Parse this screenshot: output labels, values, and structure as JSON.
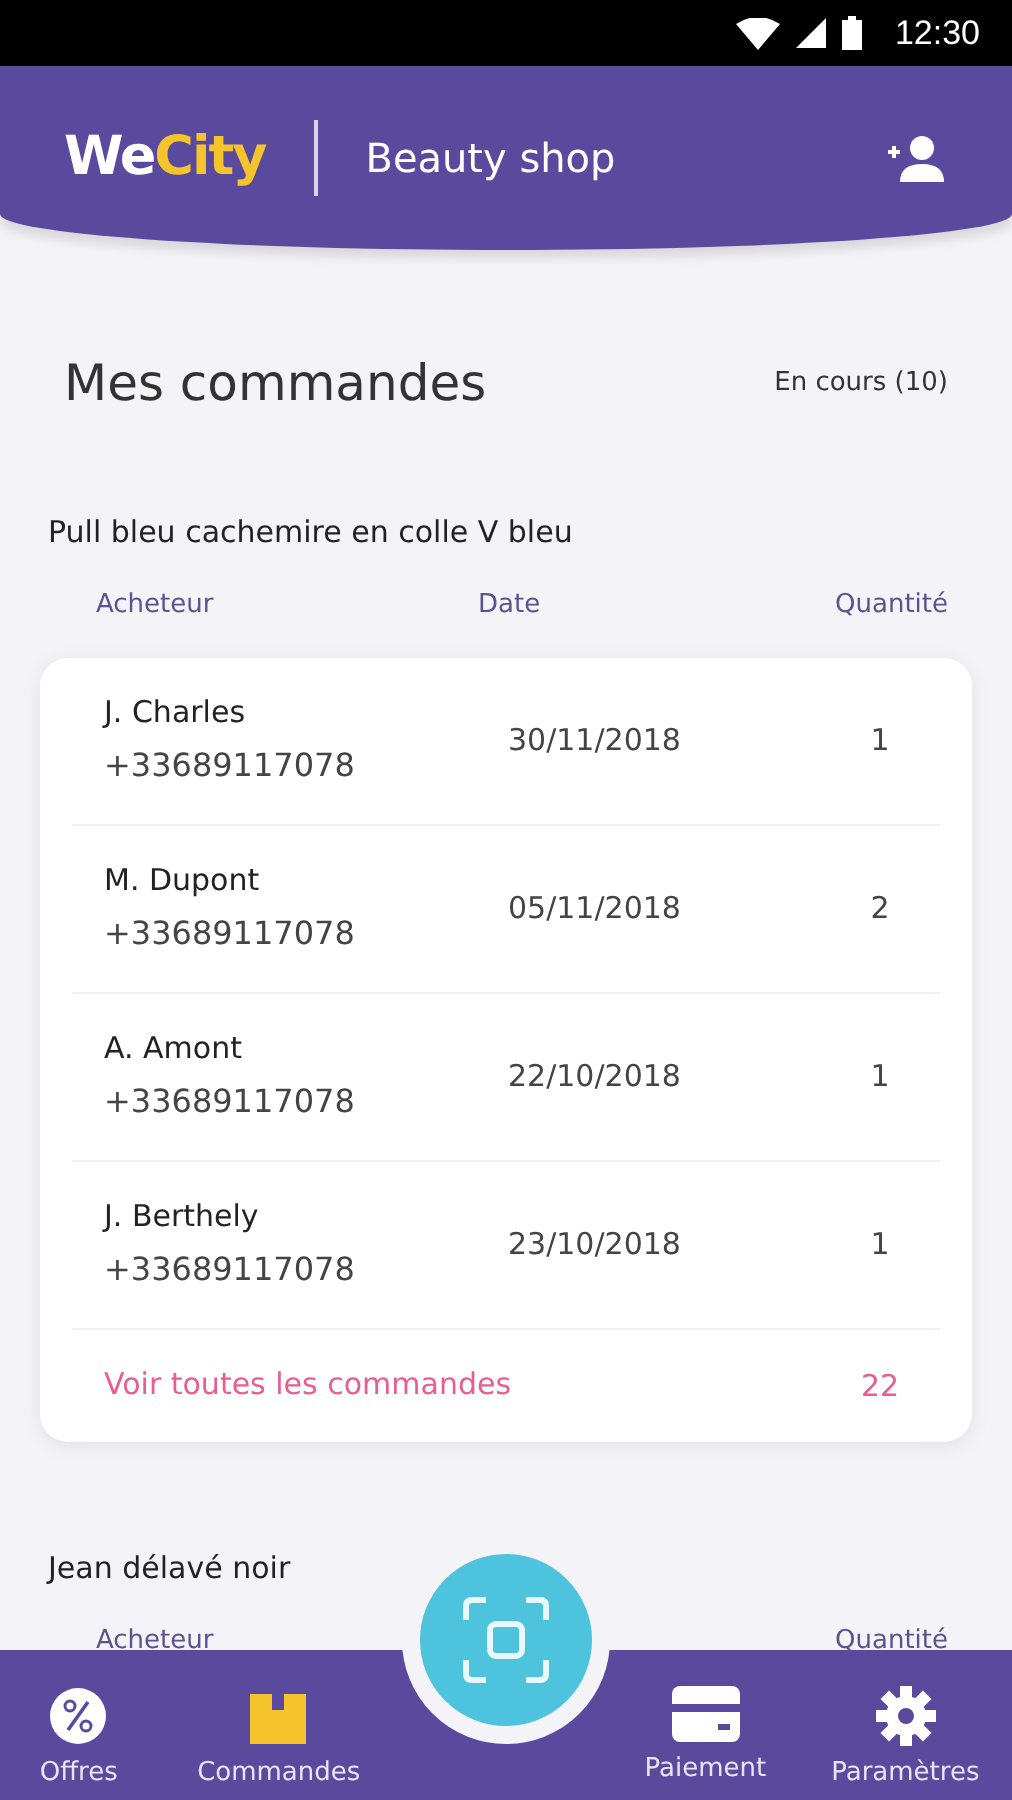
{
  "status_bar": {
    "time": "12:30"
  },
  "header": {
    "logo_parts": [
      "We",
      "City"
    ],
    "shop": "Beauty shop"
  },
  "page": {
    "title": "Mes commandes",
    "filter": "En cours (10)"
  },
  "products": [
    {
      "name": "Pull bleu cachemire en colle V bleu",
      "columns": [
        "Acheteur",
        "Date",
        "Quantité"
      ],
      "orders": [
        {
          "buyer": "J. Charles",
          "phone": "+33689117078",
          "date": "30/11/2018",
          "quantity": "1"
        },
        {
          "buyer": "M. Dupont",
          "phone": "+33689117078",
          "date": "05/11/2018",
          "quantity": "2"
        },
        {
          "buyer": "A. Amont",
          "phone": "+33689117078",
          "date": "22/10/2018",
          "quantity": "1"
        },
        {
          "buyer": "J. Berthely",
          "phone": "+33689117078",
          "date": "23/10/2018",
          "quantity": "1"
        }
      ],
      "footer": {
        "link": "Voir toutes les commandes",
        "total": "22"
      }
    },
    {
      "name": "Jean délavé noir",
      "columns": [
        "Acheteur",
        "",
        "Quantité"
      ]
    }
  ],
  "bottom_nav": [
    {
      "label": "Offres",
      "kind": "offers",
      "selected": false
    },
    {
      "label": "Commandes",
      "kind": "orders",
      "selected": true
    },
    {
      "label": "Paiement",
      "kind": "payment",
      "selected": false
    },
    {
      "label": "Paramètres",
      "kind": "settings",
      "selected": false
    }
  ]
}
